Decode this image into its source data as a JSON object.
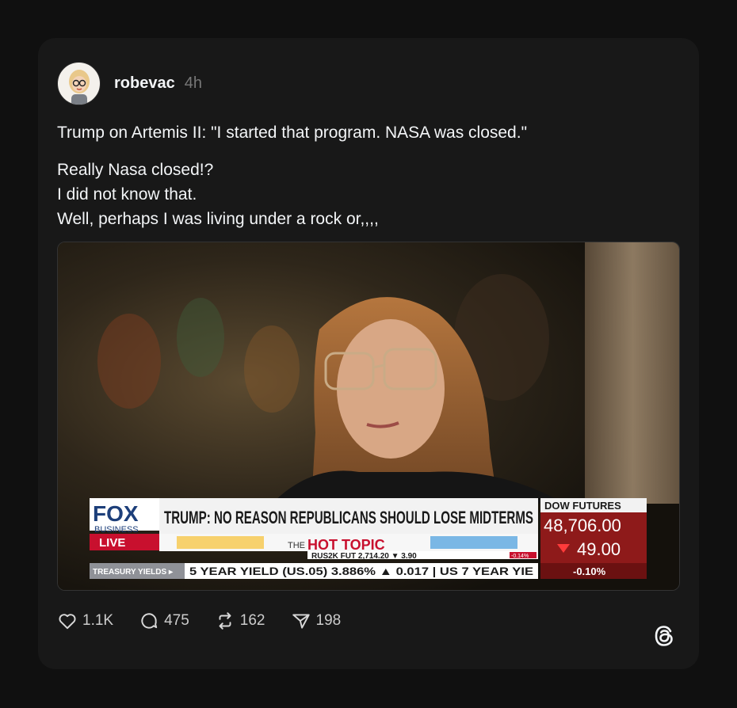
{
  "post": {
    "username": "robevac",
    "time": "4h",
    "line1": "Trump on Artemis II: \"I started that program. NASA was closed.\"",
    "line2": "Really Nasa closed!?",
    "line3": "I did not know that.",
    "line4": "Well, perhaps I was living under a rock or,,,,"
  },
  "media": {
    "network": "FOX",
    "network_sub": "BUSINESS",
    "live": "LIVE",
    "headline": "TRUMP: NO REASON REPUBLICANS SHOULD LOSE MIDTERMS",
    "segment_prefix": "THE",
    "segment": "HOT TOPIC",
    "ticker_mid": "RUS2K FUT   2,714.20  ▼ 3.90",
    "ticker_mid_pct": "-0.14%",
    "ticker_label": "TREASURY YIELDS ▸",
    "ticker": "5 YEAR YIELD (US.05)  3.886%  ▲ 0.017  |  US 7 YEAR YIE",
    "dow_label": "DOW FUTURES",
    "dow_value": "48,706.00",
    "dow_change": "49.00",
    "dow_pct": "-0.10%"
  },
  "actions": {
    "likes": "1.1K",
    "replies": "475",
    "reposts": "162",
    "shares": "198"
  },
  "colors": {
    "background": "#101010",
    "card": "#181818",
    "fox_blue": "#1d3f7a",
    "fox_red": "#c8102e",
    "dow_red": "#8e1a1a"
  }
}
